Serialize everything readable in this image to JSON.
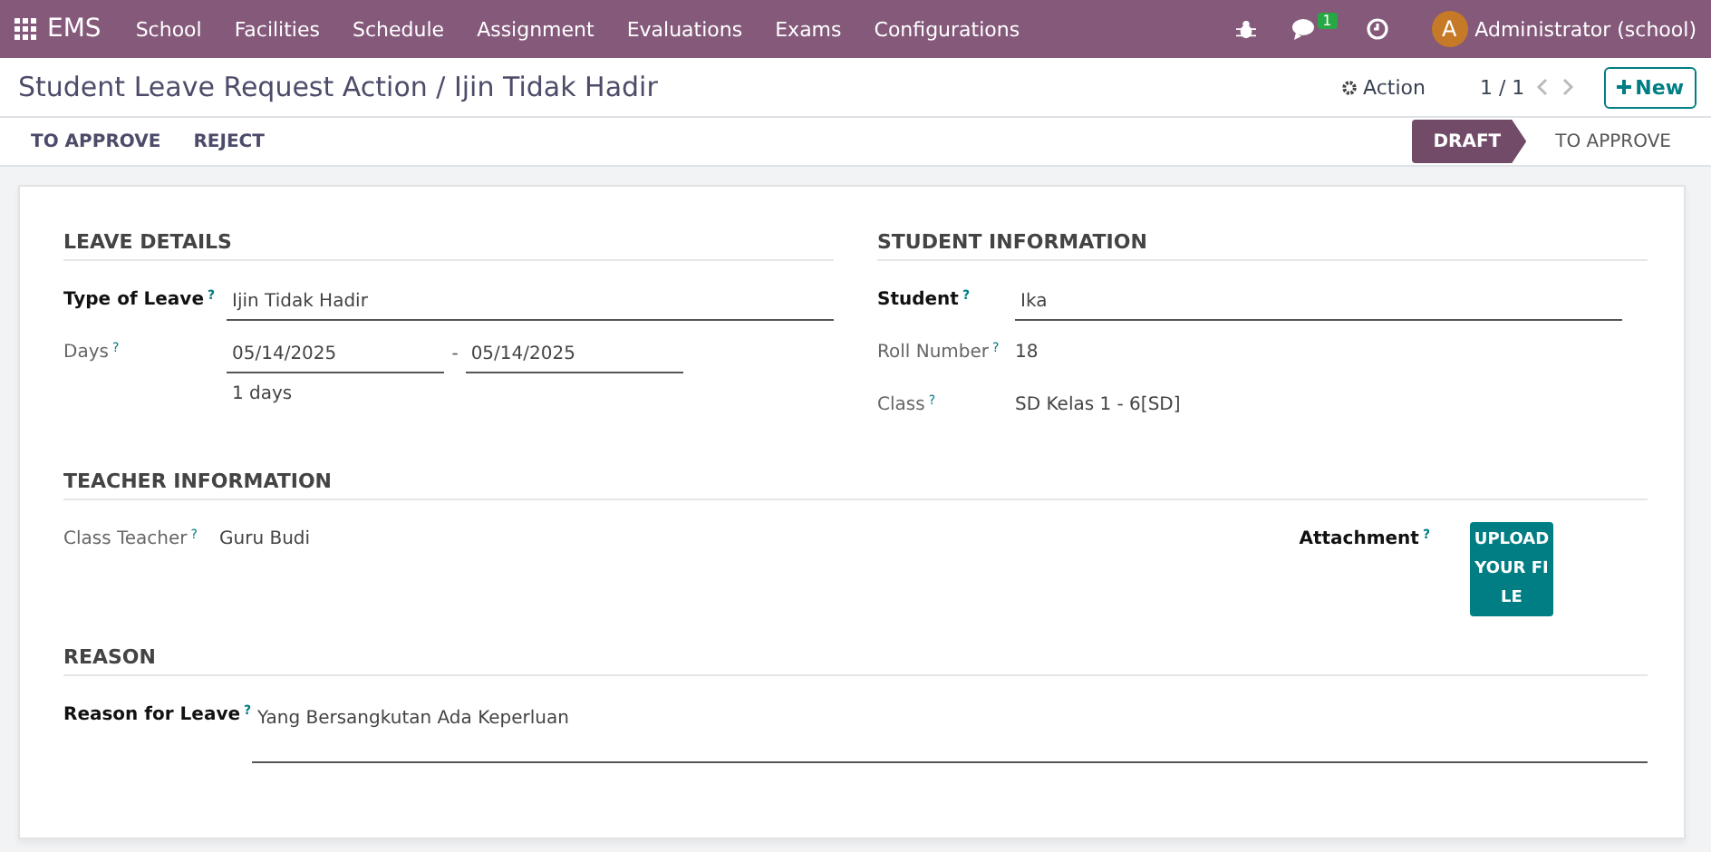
{
  "navbar": {
    "app": "EMS",
    "menus": [
      "School",
      "Facilities",
      "Schedule",
      "Assignment",
      "Evaluations",
      "Exams",
      "Configurations"
    ],
    "message_count": "1",
    "avatar_letter": "A",
    "user": "Administrator (school)"
  },
  "breadcrumb": "Student Leave Request Action / Ijin Tidak Hadir",
  "action": "Action",
  "pager": "1 / 1",
  "new_button": "New",
  "buttons": [
    "TO APPROVE",
    "REJECT"
  ],
  "stages": [
    {
      "label": "DRAFT",
      "selected": true
    },
    {
      "label": "TO APPROVE",
      "selected": false
    }
  ],
  "leave_details": {
    "title": "LEAVE DETAILS",
    "type_label": "Type of Leave$^{?}$",
    "type_required": true,
    "type_value": "Ijin Tidak Hadir",
    "days_label": "Days$^{?}$",
    "days_required": false,
    "date_from": "05/14/2025",
    "separator": "-",
    "date_to": "05/14/2025",
    "duration": "1 days"
  },
  "student_information": {
    "title": "STUDENT INFORMATION",
    "fields": [
      {
        "kind": "input",
        "label": "Student$^{?}$",
        "required": true,
        "value": "Ika"
      },
      {
        "kind": "text",
        "label": "Roll Number$^{?}$",
        "required": false,
        "value": "18"
      },
      {
        "kind": "text",
        "label": "Class$^{?}$",
        "required": false,
        "value": "SD Kelas 1 - 6[SD]"
      }
    ]
  },
  "teacher_information": {
    "title": "TEACHER INFORMATION",
    "teacher_label": "Class Teacher$^{?}$",
    "teacher_required": false,
    "teacher_value": "Guru Budi",
    "attachment_label": "Attachment$^{?}$",
    "attachment_required": true,
    "upload_button": "UPLOAD YOUR FILE"
  },
  "reason": {
    "title": "REASON",
    "label": "Reason for Leave$^{?}$",
    "required": true,
    "value": "Yang Bersangkutan Ada Keperluan"
  }
}
